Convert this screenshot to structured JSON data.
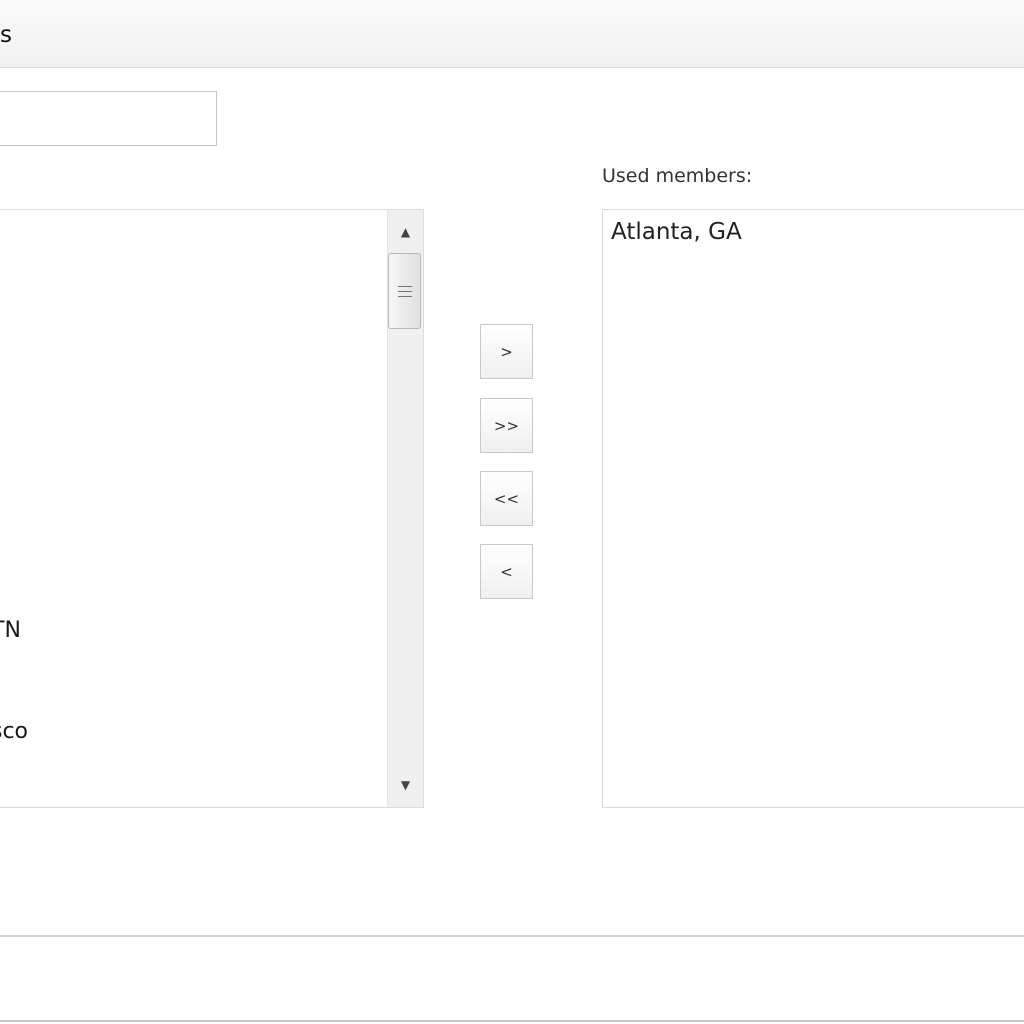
{
  "dialog": {
    "title": "s"
  },
  "filter": {
    "value": ""
  },
  "available": {
    "items": [
      {
        "label": "TN"
      },
      {
        "label": "sco"
      }
    ]
  },
  "used": {
    "label": "Used members:",
    "items": [
      {
        "label": "Atlanta, GA"
      }
    ]
  },
  "buttons": {
    "add": ">",
    "add_all": ">>",
    "remove_all": "<<",
    "remove": "<"
  },
  "icons": {
    "scroll_up": "triangle-up",
    "scroll_down": "triangle-down",
    "scroll_grip": "three-line-grip"
  }
}
